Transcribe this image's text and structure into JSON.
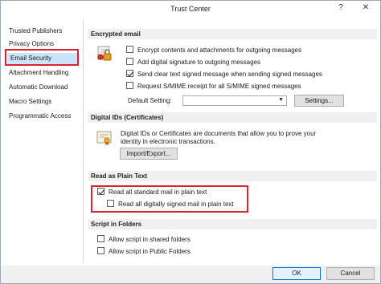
{
  "window": {
    "title": "Trust Center",
    "help_glyph": "?",
    "close_glyph": "✕"
  },
  "sidebar": {
    "items": [
      {
        "label": "Trusted Publishers"
      },
      {
        "label": "Privacy Options"
      },
      {
        "label": "Email Security"
      },
      {
        "label": "Attachment Handling"
      },
      {
        "label": "Automatic Download"
      },
      {
        "label": "Macro Settings"
      },
      {
        "label": "Programmatic Access"
      }
    ],
    "selected": "Email Security"
  },
  "encrypted_email": {
    "header": "Encrypted email",
    "options": [
      {
        "label": "Encrypt contents and attachments for outgoing messages",
        "checked": false
      },
      {
        "label": "Add digital signature to outgoing messages",
        "checked": false
      },
      {
        "label": "Send clear text signed message when sending signed messages",
        "checked": true
      },
      {
        "label": "Request S/MIME receipt for all S/MIME signed messages",
        "checked": false
      }
    ],
    "default_setting_label": "Default Setting:",
    "default_setting_value": "",
    "settings_button": "Settings..."
  },
  "digital_ids": {
    "header": "Digital IDs (Certificates)",
    "description": "Digital IDs or Certificates are documents that allow you to prove your identity in electronic transactions.",
    "import_export_button": "Import/Export..."
  },
  "read_plain": {
    "header": "Read as Plain Text",
    "options": [
      {
        "label": "Read all standard mail in plain text",
        "checked": true
      },
      {
        "label": "Read all digitally signed mail in plain text",
        "checked": false
      }
    ]
  },
  "script_folders": {
    "header": "Script in Folders",
    "options": [
      {
        "label": "Allow script in shared folders",
        "checked": false
      },
      {
        "label": "Allow script in Public Folders",
        "checked": false
      }
    ]
  },
  "footer": {
    "ok": "OK",
    "cancel": "Cancel"
  },
  "colors": {
    "highlight": "#d9232e",
    "selection": "#cce4f7",
    "header_bg": "#f0f0f0"
  }
}
